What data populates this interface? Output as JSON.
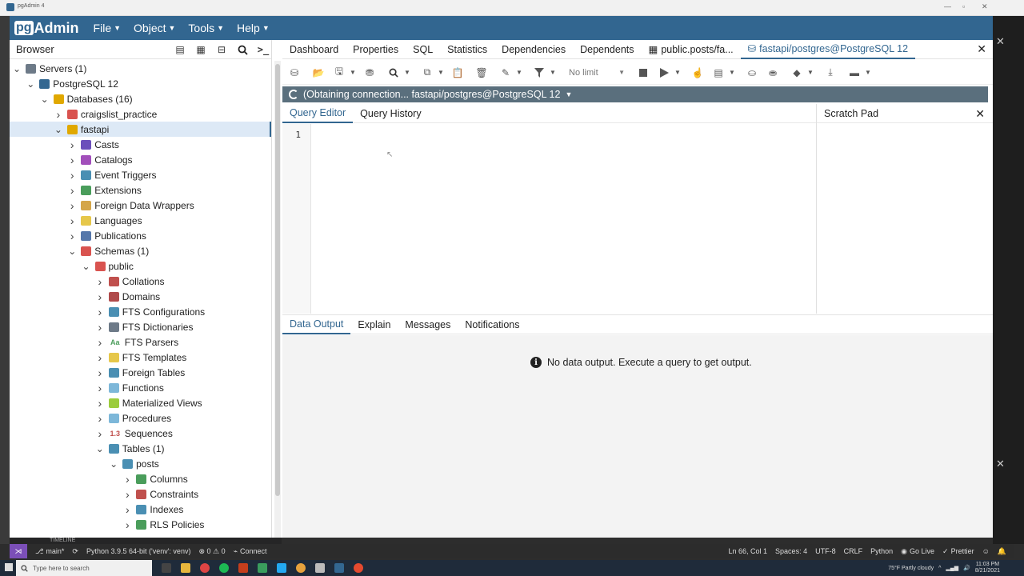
{
  "window": {
    "title": "pgAdmin 4"
  },
  "menubar": {
    "logo_pg": "pg",
    "logo_admin": "Admin",
    "items": [
      {
        "label": "File"
      },
      {
        "label": "Object"
      },
      {
        "label": "Tools"
      },
      {
        "label": "Help"
      }
    ]
  },
  "browser": {
    "title": "Browser",
    "tree": [
      {
        "label": "Servers (1)",
        "depth": 0,
        "expanded": true,
        "icon": "servers-icon",
        "color": "#6d7a88"
      },
      {
        "label": "PostgreSQL 12",
        "depth": 1,
        "expanded": true,
        "icon": "elephant-icon",
        "color": "#336791"
      },
      {
        "label": "Databases (16)",
        "depth": 2,
        "expanded": true,
        "icon": "databases-icon",
        "color": "#e0a800"
      },
      {
        "label": "craigslist_practice",
        "depth": 3,
        "expanded": false,
        "icon": "database-icon",
        "color": "#d9534f"
      },
      {
        "label": "fastapi",
        "depth": 3,
        "expanded": true,
        "icon": "database-icon",
        "color": "#e0a800",
        "selected": true
      },
      {
        "label": "Casts",
        "depth": 4,
        "expanded": false,
        "icon": "casts-icon",
        "color": "#6b4fbb"
      },
      {
        "label": "Catalogs",
        "depth": 4,
        "expanded": false,
        "icon": "catalogs-icon",
        "color": "#a24fbb"
      },
      {
        "label": "Event Triggers",
        "depth": 4,
        "expanded": false,
        "icon": "event-trigger-icon",
        "color": "#4a8fb3"
      },
      {
        "label": "Extensions",
        "depth": 4,
        "expanded": false,
        "icon": "extensions-icon",
        "color": "#4a9d5b"
      },
      {
        "label": "Foreign Data Wrappers",
        "depth": 4,
        "expanded": false,
        "icon": "fdw-icon",
        "color": "#d4a64a"
      },
      {
        "label": "Languages",
        "depth": 4,
        "expanded": false,
        "icon": "languages-icon",
        "color": "#e6c74a"
      },
      {
        "label": "Publications",
        "depth": 4,
        "expanded": false,
        "icon": "publications-icon",
        "color": "#5577aa"
      },
      {
        "label": "Schemas (1)",
        "depth": 4,
        "expanded": true,
        "icon": "schemas-icon",
        "color": "#d9534f"
      },
      {
        "label": "public",
        "depth": 5,
        "expanded": true,
        "icon": "schema-icon",
        "color": "#d9534f"
      },
      {
        "label": "Collations",
        "depth": 6,
        "expanded": false,
        "icon": "collations-icon",
        "color": "#c0504d"
      },
      {
        "label": "Domains",
        "depth": 6,
        "expanded": false,
        "icon": "domains-icon",
        "color": "#b04a4a"
      },
      {
        "label": "FTS Configurations",
        "depth": 6,
        "expanded": false,
        "icon": "fts-config-icon",
        "color": "#4a8fb3"
      },
      {
        "label": "FTS Dictionaries",
        "depth": 6,
        "expanded": false,
        "icon": "fts-dict-icon",
        "color": "#6d7a88"
      },
      {
        "label": "FTS Parsers",
        "depth": 6,
        "expanded": false,
        "icon": "fts-parser-icon",
        "color": "#4a9d5b",
        "glyph": "Aa"
      },
      {
        "label": "FTS Templates",
        "depth": 6,
        "expanded": false,
        "icon": "fts-template-icon",
        "color": "#e6c74a"
      },
      {
        "label": "Foreign Tables",
        "depth": 6,
        "expanded": false,
        "icon": "foreign-table-icon",
        "color": "#4a8fb3"
      },
      {
        "label": "Functions",
        "depth": 6,
        "expanded": false,
        "icon": "functions-icon",
        "color": "#7db7d9"
      },
      {
        "label": "Materialized Views",
        "depth": 6,
        "expanded": false,
        "icon": "mat-views-icon",
        "color": "#9ccc3d"
      },
      {
        "label": "Procedures",
        "depth": 6,
        "expanded": false,
        "icon": "procedures-icon",
        "color": "#7db7d9"
      },
      {
        "label": "Sequences",
        "depth": 6,
        "expanded": false,
        "icon": "sequences-icon",
        "color": "#c0504d",
        "glyph": "1.3"
      },
      {
        "label": "Tables (1)",
        "depth": 6,
        "expanded": true,
        "icon": "tables-icon",
        "color": "#4a8fb3"
      },
      {
        "label": "posts",
        "depth": 7,
        "expanded": true,
        "icon": "table-icon",
        "color": "#4a8fb3"
      },
      {
        "label": "Columns",
        "depth": 8,
        "expanded": false,
        "icon": "columns-icon",
        "color": "#4a9d5b"
      },
      {
        "label": "Constraints",
        "depth": 8,
        "expanded": false,
        "icon": "constraints-icon",
        "color": "#c0504d"
      },
      {
        "label": "Indexes",
        "depth": 8,
        "expanded": false,
        "icon": "indexes-icon",
        "color": "#4a8fb3"
      },
      {
        "label": "RLS Policies",
        "depth": 8,
        "expanded": false,
        "icon": "rls-icon",
        "color": "#4a9d5b"
      }
    ]
  },
  "main": {
    "tabs": [
      {
        "label": "Dashboard"
      },
      {
        "label": "Properties"
      },
      {
        "label": "SQL"
      },
      {
        "label": "Statistics"
      },
      {
        "label": "Dependencies"
      },
      {
        "label": "Dependents"
      },
      {
        "label": "public.posts/fa..."
      },
      {
        "label": "fastapi/postgres@PostgreSQL 12"
      }
    ],
    "toolbar": {
      "limit_value": "No limit"
    },
    "connection_status": "(Obtaining connection... fastapi/postgres@PostgreSQL 12",
    "query_tabs": [
      {
        "label": "Query Editor"
      },
      {
        "label": "Query History"
      }
    ],
    "scratch_pad": "Scratch Pad",
    "editor_line": "1",
    "output_tabs": [
      {
        "label": "Data Output"
      },
      {
        "label": "Explain"
      },
      {
        "label": "Messages"
      },
      {
        "label": "Notifications"
      }
    ],
    "no_data": "No data output. Execute a query to get output."
  },
  "statusbar": {
    "timeline": "TIMELINE",
    "branch": "main*",
    "python": "Python 3.9.5 64-bit ('venv': venv)",
    "problems": "⊗ 0 ⚠ 0",
    "connect": "Connect",
    "position": "Ln 66, Col 1",
    "spaces": "Spaces: 4",
    "encoding": "UTF-8",
    "eol": "CRLF",
    "language": "Python",
    "golive": "Go Live",
    "prettier": "Prettier"
  },
  "taskbar": {
    "search_placeholder": "Type here to search",
    "weather": "75°F  Partly cloudy",
    "time": "11:03 PM",
    "date": "8/21/2021"
  },
  "colors": {
    "brand": "#326690",
    "conn_bar": "#5a6f7d",
    "selected_row": "#dde9f6"
  }
}
